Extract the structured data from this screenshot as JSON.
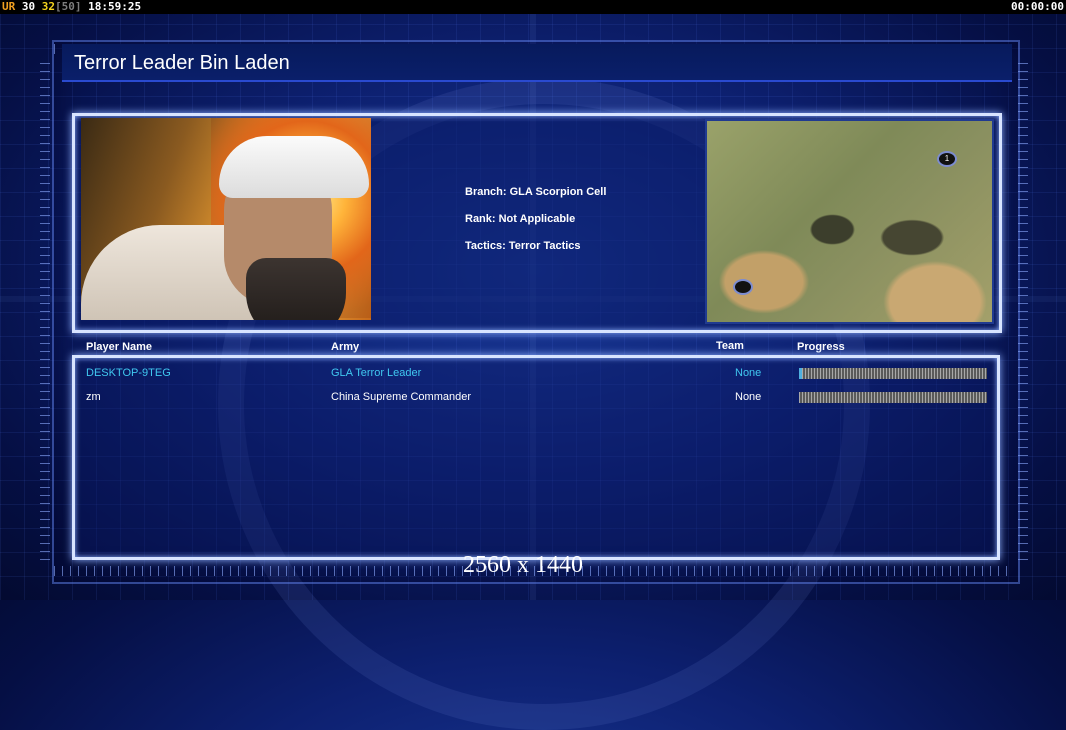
{
  "hud": {
    "tag": "UR",
    "num1": "30",
    "num2": "32",
    "bracket": "[50]",
    "clock": "18:59:25",
    "timer": "00:00:00"
  },
  "title": "Terror Leader Bin Laden",
  "general": {
    "branch": "Branch: GLA Scorpion Cell",
    "rank": "Rank: Not Applicable",
    "tactics": "Tactics: Terror Tactics"
  },
  "minimap": {
    "marker_1": "1"
  },
  "columns": {
    "player": "Player Name",
    "army": "Army",
    "team": "Team",
    "progress": "Progress"
  },
  "players": [
    {
      "name": "DESKTOP-9TEG",
      "army": "GLA Terror Leader",
      "team": "None",
      "progress": 0.01,
      "color": "#40c8f0"
    },
    {
      "name": "zm",
      "army": "China Supreme Commander",
      "team": "None",
      "progress": 0,
      "color": "#ffffff"
    }
  ],
  "resolution_label": "2560 x 1440",
  "colors": {
    "accent": "#d8e4ff",
    "local_player": "#40c8f0"
  }
}
